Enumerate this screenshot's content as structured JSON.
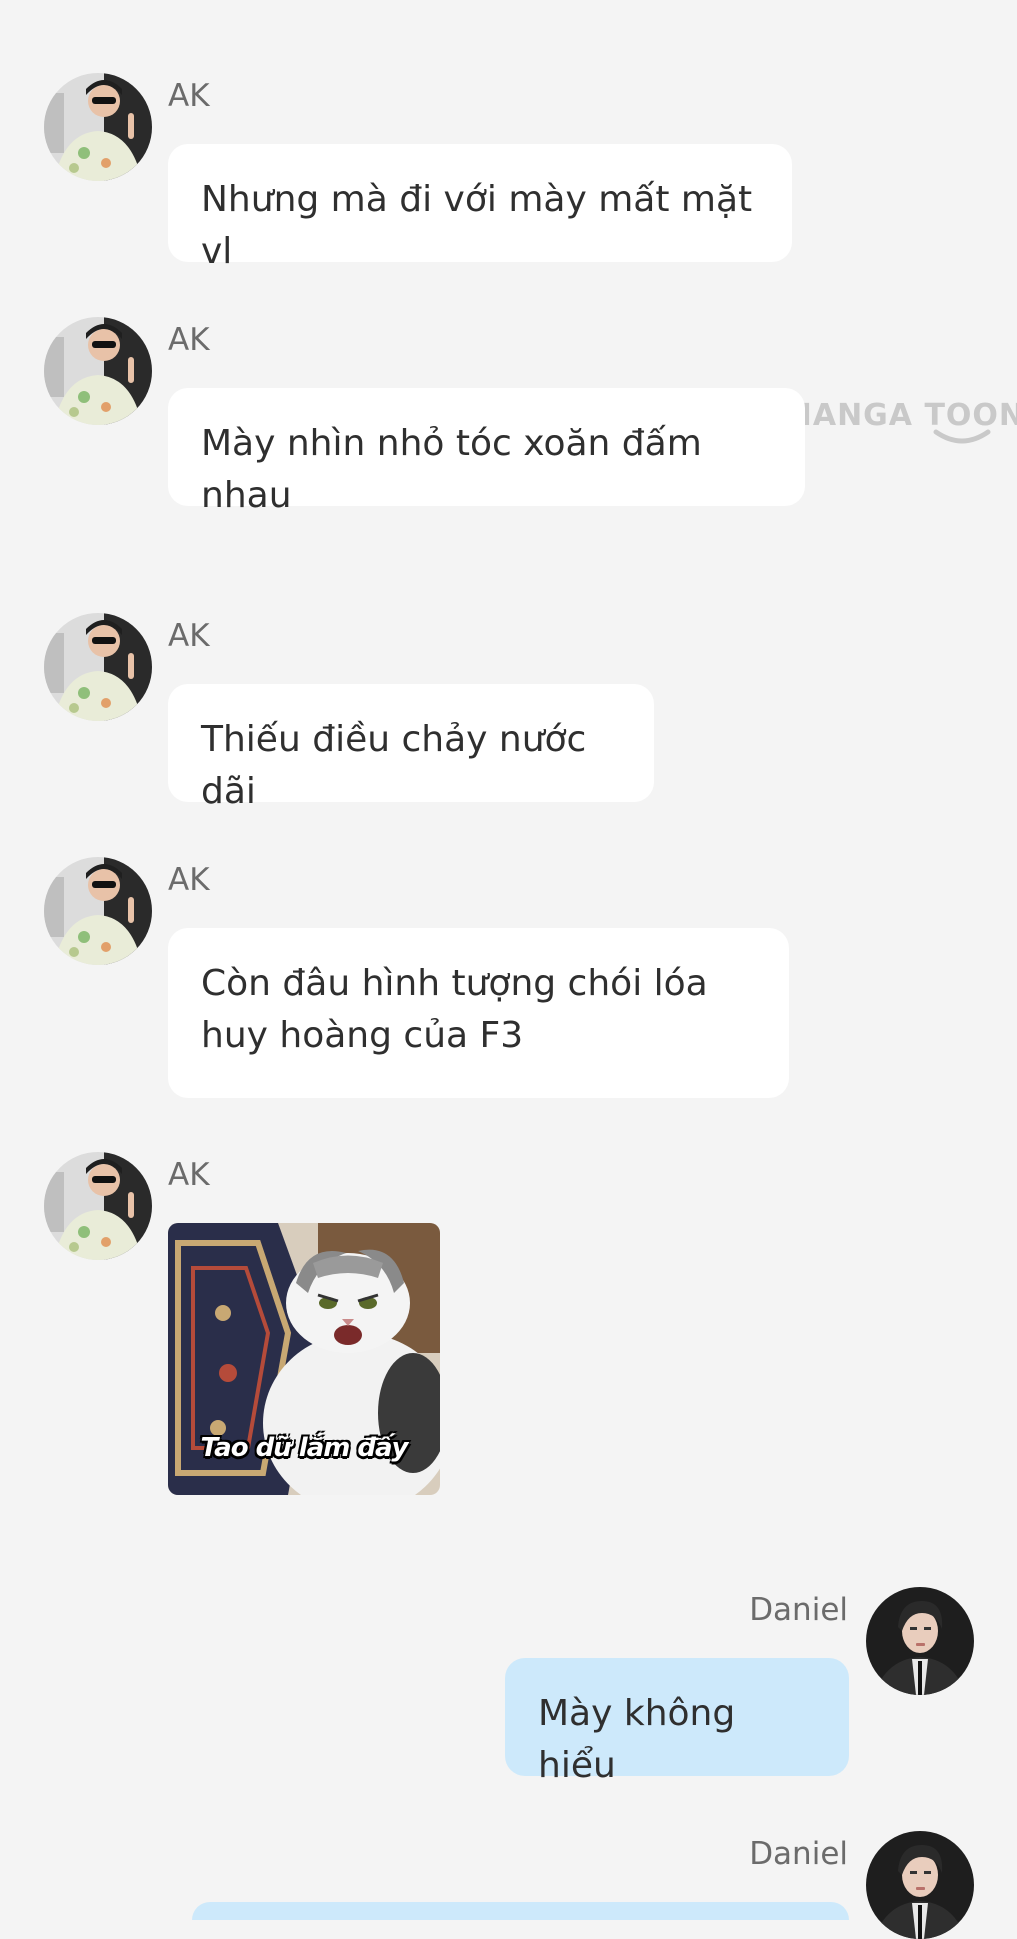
{
  "watermark": {
    "text": "MANGA TOON"
  },
  "messages": [
    {
      "sender": "AK",
      "side": "left",
      "type": "text",
      "text": "Nhưng mà đi với mày mất mặt vl"
    },
    {
      "sender": "AK",
      "side": "left",
      "type": "text",
      "text": "Mày nhìn nhỏ tóc xoăn đấm nhau"
    },
    {
      "sender": "AK",
      "side": "left",
      "type": "text",
      "text": "Thiếu điều chảy nước dãi"
    },
    {
      "sender": "AK",
      "side": "left",
      "type": "text",
      "text": "Còn đâu hình tượng chói lóa huy hoàng của F3"
    },
    {
      "sender": "AK",
      "side": "left",
      "type": "sticker",
      "sticker_caption": "Tao dữ lắm đấy",
      "sticker_icon": "angry-cat-sticker"
    },
    {
      "sender": "Daniel",
      "side": "right",
      "type": "text",
      "text": "Mày không hiểu"
    },
    {
      "sender": "Daniel",
      "side": "right",
      "type": "text",
      "text": ""
    }
  ],
  "colors": {
    "background": "#f4f4f4",
    "incoming_bubble": "#ffffff",
    "outgoing_bubble": "#cde9fb",
    "name_text": "#6b6b6b",
    "message_text": "#2f2f2f"
  }
}
